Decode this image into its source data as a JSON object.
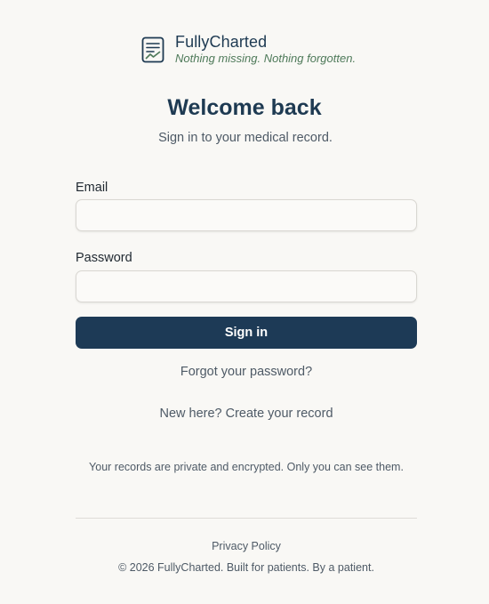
{
  "brand": {
    "name": "FullyCharted",
    "tagline": "Nothing missing. Nothing forgotten.",
    "icon": "chart-document-icon"
  },
  "heading": {
    "title": "Welcome back",
    "subtitle": "Sign in to your medical record."
  },
  "form": {
    "email_label": "Email",
    "email_value": "",
    "password_label": "Password",
    "password_value": "",
    "submit_label": "Sign in"
  },
  "links": {
    "forgot_password": "Forgot your password?",
    "create_record": "New here? Create your record"
  },
  "privacy_note": "Your records are private and encrypted. Only you can see them.",
  "footer": {
    "privacy_policy": "Privacy Policy",
    "copyright": "© 2026 FullyCharted. Built for patients. By a patient."
  },
  "colors": {
    "background": "#f9f8f5",
    "primary": "#1d3a56",
    "tagline": "#4f7a5a",
    "muted_text": "#4e5a66"
  }
}
